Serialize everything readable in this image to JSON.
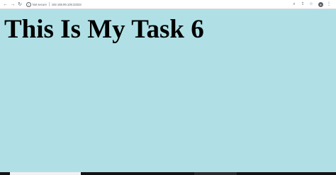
{
  "browser": {
    "security_status": "Not secure",
    "url": "192.168.99.105:33333",
    "icons": {
      "back": "back-arrow-icon",
      "forward": "forward-arrow-icon",
      "reload": "reload-icon",
      "info": "info-icon",
      "zoom": "zoom-icon",
      "share": "share-icon",
      "bookmark": "star-icon",
      "profile": "avatar-icon",
      "menu": "menu-icon"
    }
  },
  "page": {
    "heading": "This Is My Task 6",
    "background_color": "#b0e0e6"
  }
}
